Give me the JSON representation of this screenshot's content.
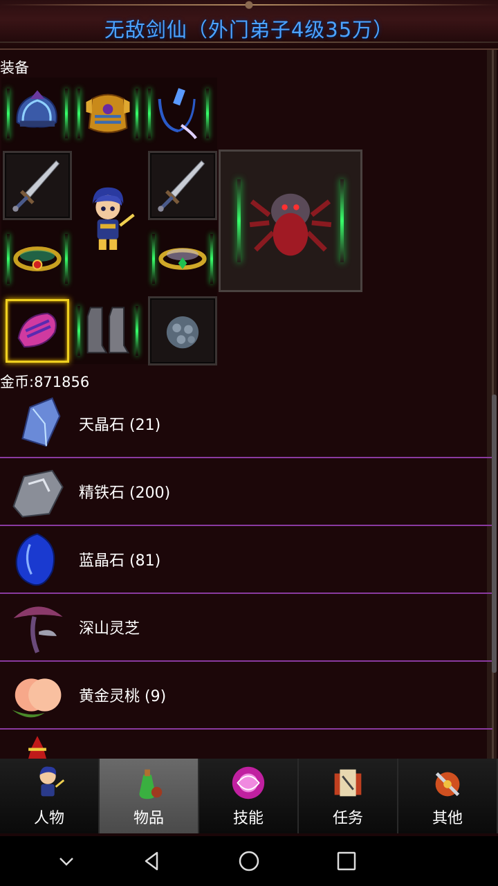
{
  "title": "无敌剑仙（外门弟子4级35万）",
  "equipment": {
    "section_label": "装备",
    "slots": [
      {
        "id": "helmet",
        "icon": "helmet-icon"
      },
      {
        "id": "armor",
        "icon": "armor-icon"
      },
      {
        "id": "necklace",
        "icon": "necklace-icon"
      },
      {
        "id": "weapon-left",
        "icon": "sword-icon"
      },
      {
        "id": "character",
        "icon": "character-icon"
      },
      {
        "id": "weapon-right",
        "icon": "sword-icon"
      },
      {
        "id": "ring-left",
        "icon": "ring-icon"
      },
      {
        "id": "ring-right",
        "icon": "ring-icon"
      },
      {
        "id": "gloves",
        "icon": "gloves-icon"
      },
      {
        "id": "boots",
        "icon": "boots-icon"
      },
      {
        "id": "accessory",
        "icon": "orb-icon"
      },
      {
        "id": "mount",
        "icon": "spider-mount-icon"
      }
    ]
  },
  "gold": "金币:871856",
  "items": [
    {
      "name": "天晶石 (21)",
      "icon": "sky-crystal-icon"
    },
    {
      "name": "精铁石 (200)",
      "icon": "iron-ore-icon"
    },
    {
      "name": "蓝晶石 (81)",
      "icon": "blue-crystal-icon"
    },
    {
      "name": "深山灵芝",
      "icon": "lingzhi-mushroom-icon"
    },
    {
      "name": "黄金灵桃 (9)",
      "icon": "golden-peach-icon"
    },
    {
      "name": "",
      "icon": "red-potion-icon"
    }
  ],
  "tabs": [
    {
      "label": "人物",
      "icon": "character-tab-icon",
      "active": false
    },
    {
      "label": "物品",
      "icon": "potion-tab-icon",
      "active": true
    },
    {
      "label": "技能",
      "icon": "skill-orb-tab-icon",
      "active": false
    },
    {
      "label": "任务",
      "icon": "quest-scroll-tab-icon",
      "active": false
    },
    {
      "label": "其他",
      "icon": "other-tab-icon",
      "active": false
    }
  ],
  "colors": {
    "title": "#4da3ff",
    "background": "#1c0709",
    "row_divider": "#8a3aa0",
    "slot_glow": "#37ff6a"
  }
}
